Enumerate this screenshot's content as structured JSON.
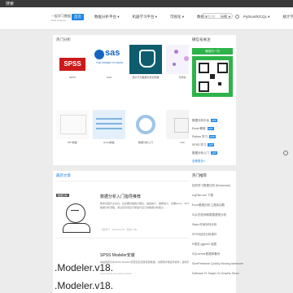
{
  "window": {
    "title": "搜索"
  },
  "brand": {
    "name": "一起学习数据",
    "slogan": "Data Analysis"
  },
  "nav": [
    {
      "label": "首页",
      "active": true
    },
    {
      "label": "数据分析平台 ▾",
      "active": false
    },
    {
      "label": "机器学习平台 ▾",
      "active": false
    },
    {
      "label": "可视化 ▾",
      "active": false
    },
    {
      "label": "数据 ▾",
      "active": false
    },
    {
      "label": "分析 ▾",
      "active": false
    },
    {
      "label": "Python/R/CQL ▾",
      "active": false
    },
    {
      "label": "统计学教程",
      "active": false
    }
  ],
  "search": {
    "placeholder": "搜索文章"
  },
  "recommend": {
    "title": "热门分析",
    "items": [
      {
        "label": "SPSS"
      },
      {
        "label": "SAS"
      },
      {
        "label": "用户行为数据分析如何做"
      },
      {
        "label": "可视化"
      },
      {
        "label": "PPT模板"
      },
      {
        "label": "Excel模板"
      },
      {
        "label": "数据分析入门"
      },
      {
        "label": "Null"
      }
    ]
  },
  "sidebar": {
    "title": "微信号关注",
    "wechat_label": "微信扫一扫",
    "links": [
      {
        "label": "数据分析平台",
        "badge": "APP"
      },
      {
        "label": "Excel 教程",
        "badge": "APP"
      },
      {
        "label": "Python 学习",
        "badge": "APP"
      },
      {
        "label": "SPSS 学习",
        "badge": "APP"
      },
      {
        "label": "数据分析入门",
        "badge": "APP"
      }
    ],
    "more": "查看更多>"
  },
  "latest": {
    "title": "最新文章",
    "posts": [
      {
        "tag": "数据分析",
        "title": "数据分析入门指导推荐",
        "body": "数学基础不必太好，先掌握基础统计理论、描述统计、推断统计，掌握Excel、SPSS基础操作，学习SQL和Python，了解数据分析流程，通过实际项目不断提升自己的数据分析能力……",
        "meta": "一起学习 · 2023-04-05 · 阅读 1.8k"
      },
      {
        "tag": "",
        "title": "SPSS Modeler安装",
        "body": "本站免费分享SPSS Modeler安装包及完整安装教程，请按照步骤逐步操作，遇到问题欢迎留言。",
        "meta": "https://spss.example/modeler"
      }
    ],
    "banner1": ".Modeler.v18.",
    "banner2": ".Modeler.v18."
  },
  "hot": {
    "title": "热门推荐",
    "items": [
      "如何学习数据分析 (Bookmark)",
      "logFiter.exe 下载",
      "Excel数据分析工具库加载",
      "SQL的查询和数据透视分析",
      "Stata 时间序列分析",
      "SPSS回归分析操作",
      "R语言 ggplot2 绘图",
      "SQLserver数据库备份",
      "SurePresence Quickly Moving Awesome",
      "Software To Target On Graphic Show"
    ]
  }
}
